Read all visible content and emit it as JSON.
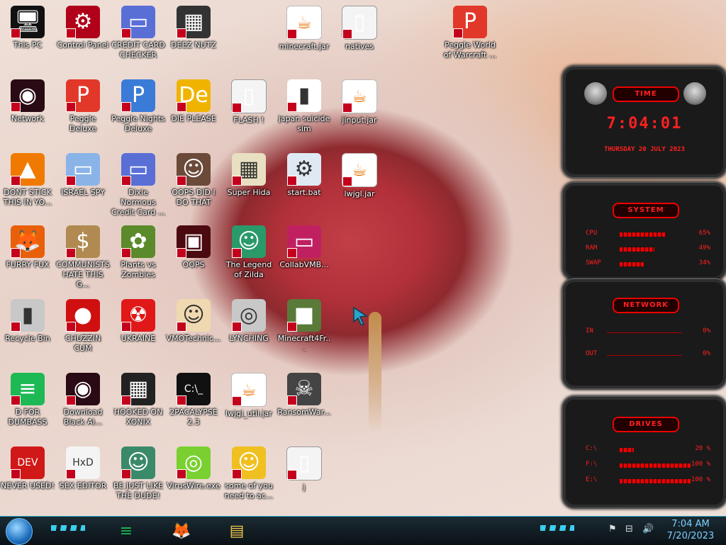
{
  "desktop_icons": [
    {
      "label": "This PC",
      "glyph": "🖥",
      "bg": "#111"
    },
    {
      "label": "Control Panel",
      "glyph": "⚙",
      "bg": "#b0001a"
    },
    {
      "label": "CREDIT CARD CHECKER",
      "glyph": "▭",
      "bg": "#5a6fd6"
    },
    {
      "label": "DEEZ NUTZ",
      "glyph": "▦",
      "bg": "#333"
    },
    {
      "label": "minecraft.jar",
      "glyph": "☕",
      "type": "java"
    },
    {
      "label": "natives",
      "glyph": "▯",
      "type": "file"
    },
    {
      "label": "Peggle World of Warcraft ...",
      "glyph": "P",
      "bg": "#e2382a"
    },
    {
      "label": "Network",
      "glyph": "◉",
      "bg": "#2a0a14"
    },
    {
      "label": "Peggle Deluxe",
      "glyph": "P",
      "bg": "#e2382a"
    },
    {
      "label": "Peggle Nights Deluxe",
      "glyph": "P",
      "bg": "#3b7bd8"
    },
    {
      "label": "DIE PLEASE",
      "glyph": "De",
      "bg": "#f0b400"
    },
    {
      "label": "FLASH !",
      "glyph": "▯",
      "type": "file"
    },
    {
      "label": "japan suicide sim",
      "glyph": "▮",
      "bg": "#fff"
    },
    {
      "label": "jinput.jar",
      "glyph": "☕",
      "type": "java"
    },
    {
      "label": "DONT STICK THIS IN YO...",
      "glyph": "▲",
      "bg": "#f07a00"
    },
    {
      "label": "ISRAEL SPY",
      "glyph": "▭",
      "bg": "#8ab4e8"
    },
    {
      "label": "Dixie Normous Credit Card ...",
      "glyph": "▭",
      "bg": "#5a6fd6"
    },
    {
      "label": "OOPS DID I DO THAT",
      "glyph": "☺",
      "bg": "#6b4a3a"
    },
    {
      "label": "Super Hida",
      "glyph": "▦",
      "bg": "#e8e0c0"
    },
    {
      "label": "start.bat",
      "glyph": "⚙",
      "bg": "#dfe9f4"
    },
    {
      "label": "lwjgl.jar",
      "glyph": "☕",
      "type": "java"
    },
    {
      "label": "FURRY FUX",
      "glyph": "🦊",
      "bg": "#e8600a"
    },
    {
      "label": "COMMUNISTS HATE THIS G...",
      "glyph": "$",
      "bg": "#b08a50"
    },
    {
      "label": "Plants vs Zombies",
      "glyph": "✿",
      "bg": "#5b8a2a"
    },
    {
      "label": "OOPS",
      "glyph": "▣",
      "bg": "#4a0a10"
    },
    {
      "label": "The Legend of Zilda",
      "glyph": "☺",
      "bg": "#2a9a6a"
    },
    {
      "label": "CollabVMB...",
      "glyph": "▭",
      "bg": "#c02060"
    },
    {
      "label": "Recycle Bin",
      "glyph": "▮",
      "bg": "#c8c8c8"
    },
    {
      "label": "CHUZZIN CUM",
      "glyph": "●",
      "bg": "#d01010"
    },
    {
      "label": "UKRAINE",
      "glyph": "☢",
      "bg": "#e01818"
    },
    {
      "label": "VMOTechnic...",
      "glyph": "☺",
      "bg": "#f0d8b0"
    },
    {
      "label": "LYNCHING",
      "glyph": "◎",
      "bg": "#c8c8c8"
    },
    {
      "label": "Minecraft4Fr...",
      "glyph": "■",
      "bg": "#5a7a3a"
    },
    {
      "label": "D FOR DUMBASS",
      "glyph": "≡",
      "bg": "#1db954"
    },
    {
      "label": "Download Black Al...",
      "glyph": "◉",
      "bg": "#2a0a14"
    },
    {
      "label": "HOOKED ON XONIX",
      "glyph": "▦",
      "bg": "#222"
    },
    {
      "label": "2PACALYPSE 2.3",
      "glyph": "C:\\_",
      "bg": "#111"
    },
    {
      "label": "lwjgl_util.jar",
      "glyph": "☕",
      "type": "java"
    },
    {
      "label": "RansomWar...",
      "glyph": "☠",
      "bg": "#444"
    },
    {
      "label": "NEVER USED!",
      "glyph": "DEV",
      "bg": "#d01818"
    },
    {
      "label": "SEX EDITOR",
      "glyph": "HxD",
      "bg": "#f4f4f4"
    },
    {
      "label": "BE JUST LIKE THE DUDE!",
      "glyph": "☺",
      "bg": "#3a8a6a"
    },
    {
      "label": "VirusWire.exe",
      "glyph": "◎",
      "bg": "#7ad030"
    },
    {
      "label": "some of you need to ac...",
      "glyph": "☺",
      "bg": "#f0c020"
    },
    {
      "label": "j",
      "glyph": "▯",
      "type": "file"
    }
  ],
  "time_widget": {
    "tag": "TIME",
    "time": "7:04:01",
    "date": "THURSDAY 20 JULY 2023"
  },
  "system_widget": {
    "tag": "SYSTEM",
    "rows": [
      {
        "label": "CPU",
        "value": "65%",
        "pct": 0.65
      },
      {
        "label": "RAM",
        "value": "49%",
        "pct": 0.49
      },
      {
        "label": "SWAP",
        "value": "34%",
        "pct": 0.34
      }
    ]
  },
  "network_widget": {
    "tag": "NETWORK",
    "rows": [
      {
        "label": "IN",
        "value": "0%"
      },
      {
        "label": "OUT",
        "value": "0%"
      }
    ]
  },
  "drives_widget": {
    "tag": "DRIVES",
    "rows": [
      {
        "label": "C:\\",
        "value": "20 %",
        "pct": 0.2
      },
      {
        "label": "F:\\",
        "value": "100 %",
        "pct": 1.0
      },
      {
        "label": "E:\\",
        "value": "100 %",
        "pct": 1.0
      }
    ]
  },
  "taskbar": {
    "pinned": [
      {
        "name": "spotify",
        "glyph": "≡",
        "color": "#1db954"
      },
      {
        "name": "firefox",
        "glyph": "🦊",
        "color": "#e8600a"
      },
      {
        "name": "file-explorer",
        "glyph": "▤",
        "color": "#f2c94c"
      }
    ],
    "tray": [
      {
        "name": "flag-icon",
        "glyph": "⚑"
      },
      {
        "name": "network-icon",
        "glyph": "⊟"
      },
      {
        "name": "volume-icon",
        "glyph": "🔊"
      }
    ],
    "time": "7:04 AM",
    "date": "7/20/2023"
  }
}
